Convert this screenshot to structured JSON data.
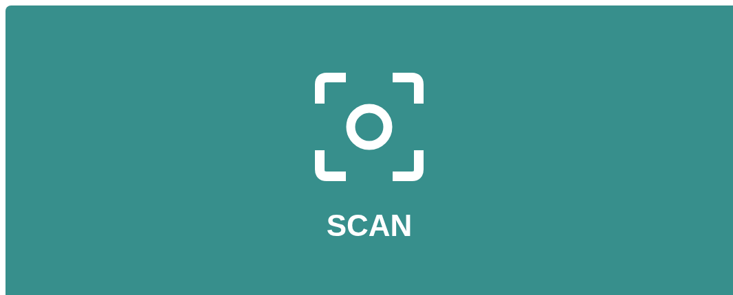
{
  "button": {
    "label": "SCAN"
  }
}
